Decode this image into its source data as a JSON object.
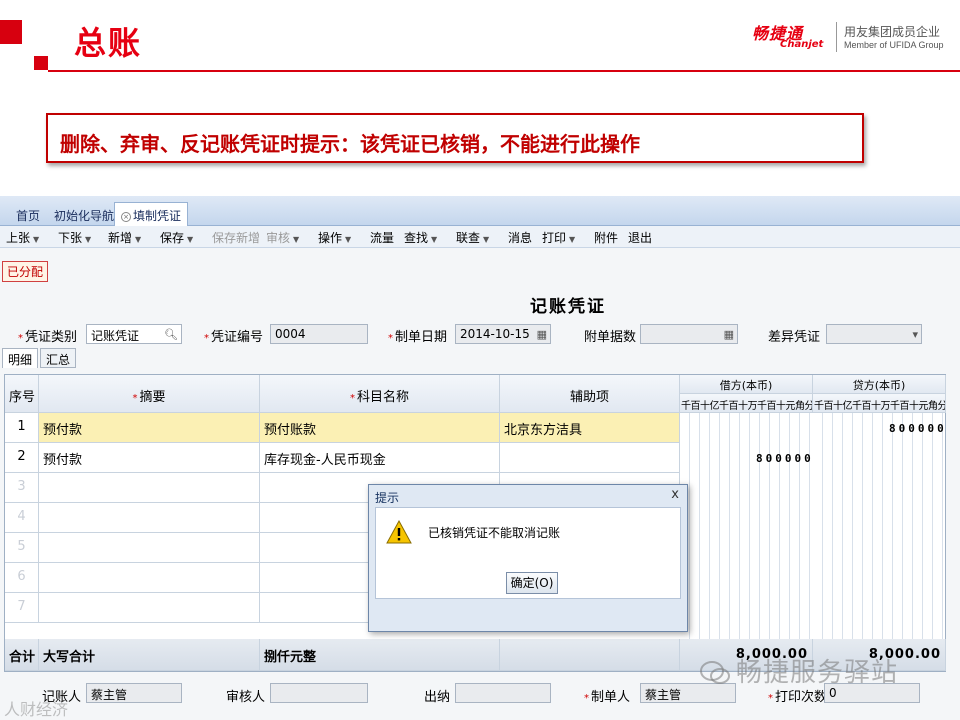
{
  "slide": {
    "title": "总账",
    "logo_cn": "畅捷通",
    "logo_en": "Chanjet",
    "logo_sub1": "用友集团成员企业",
    "logo_sub2": "Member of UFIDA Group",
    "notice": "删除、弃审、反记账凭证时提示：该凭证已核销，不能进行此操作"
  },
  "tabs": [
    {
      "label": "首页"
    },
    {
      "label": "初始化导航"
    },
    {
      "label": "填制凭证"
    }
  ],
  "toolbar": [
    {
      "label": "上张"
    },
    {
      "label": "下张"
    },
    {
      "label": "新增"
    },
    {
      "label": "保存"
    },
    {
      "label": "保存新增"
    },
    {
      "label": "审核"
    },
    {
      "label": "操作"
    },
    {
      "label": "流量"
    },
    {
      "label": "查找"
    },
    {
      "label": "联查"
    },
    {
      "label": "消息"
    },
    {
      "label": "打印"
    },
    {
      "label": "附件"
    },
    {
      "label": "退出"
    }
  ],
  "status_badge": "已分配",
  "voucher": {
    "title": "记账凭证",
    "type_label": "凭证类别",
    "type_value": "记账凭证",
    "number_label": "凭证编号",
    "number_value": "0004",
    "date_label": "制单日期",
    "date_value": "2014-10-15",
    "attach_label": "附单据数",
    "attach_value": "",
    "diff_label": "差异凭证",
    "diff_value": ""
  },
  "subtabs": [
    {
      "label": "明细"
    },
    {
      "label": "汇总"
    }
  ],
  "grid": {
    "headers": {
      "seq": "序号",
      "summary": "摘要",
      "account": "科目名称",
      "aux": "辅助项",
      "debit": "借方(本币)",
      "credit": "贷方(本币)",
      "digits": "千百十亿千百十万千百十元角分"
    },
    "rows": [
      {
        "seq": "1",
        "summary": "预付款",
        "account": "预付账款",
        "aux": "北京东方洁具",
        "debit": "",
        "credit": "800000"
      },
      {
        "seq": "2",
        "summary": "预付款",
        "account": "库存现金-人民币现金",
        "aux": "",
        "debit": "800000",
        "credit": ""
      },
      {
        "seq": "3",
        "summary": "",
        "account": "",
        "aux": "",
        "debit": "",
        "credit": ""
      },
      {
        "seq": "4",
        "summary": "",
        "account": "",
        "aux": "",
        "debit": "",
        "credit": ""
      },
      {
        "seq": "5",
        "summary": "",
        "account": "",
        "aux": "",
        "debit": "",
        "credit": ""
      },
      {
        "seq": "6",
        "summary": "",
        "account": "",
        "aux": "",
        "debit": "",
        "credit": ""
      },
      {
        "seq": "7",
        "summary": "",
        "account": "",
        "aux": "",
        "debit": "",
        "credit": ""
      }
    ],
    "total": {
      "label": "合计",
      "caps_label": "大写合计",
      "caps_value": "捌仟元整",
      "debit": "8,000.00",
      "credit": "8,000.00"
    }
  },
  "footer": {
    "bookkeeper_label": "记账人",
    "bookkeeper_value": "蔡主管",
    "reviewer_label": "审核人",
    "reviewer_value": "",
    "cashier_label": "出纳",
    "cashier_value": "",
    "maker_label": "制单人",
    "maker_value": "蔡主管",
    "prints_label": "打印次数",
    "prints_value": "0"
  },
  "dialog": {
    "title": "提示",
    "close": "x",
    "message": "已核销凭证不能取消记账",
    "ok": "确定(O)"
  },
  "watermark": {
    "text": "畅捷服务驿站",
    "text2": "人财经济"
  },
  "colors": {
    "brand_red": "#e60012",
    "notice_red": "#c00000",
    "highlight_row": "#fbf0b4"
  }
}
